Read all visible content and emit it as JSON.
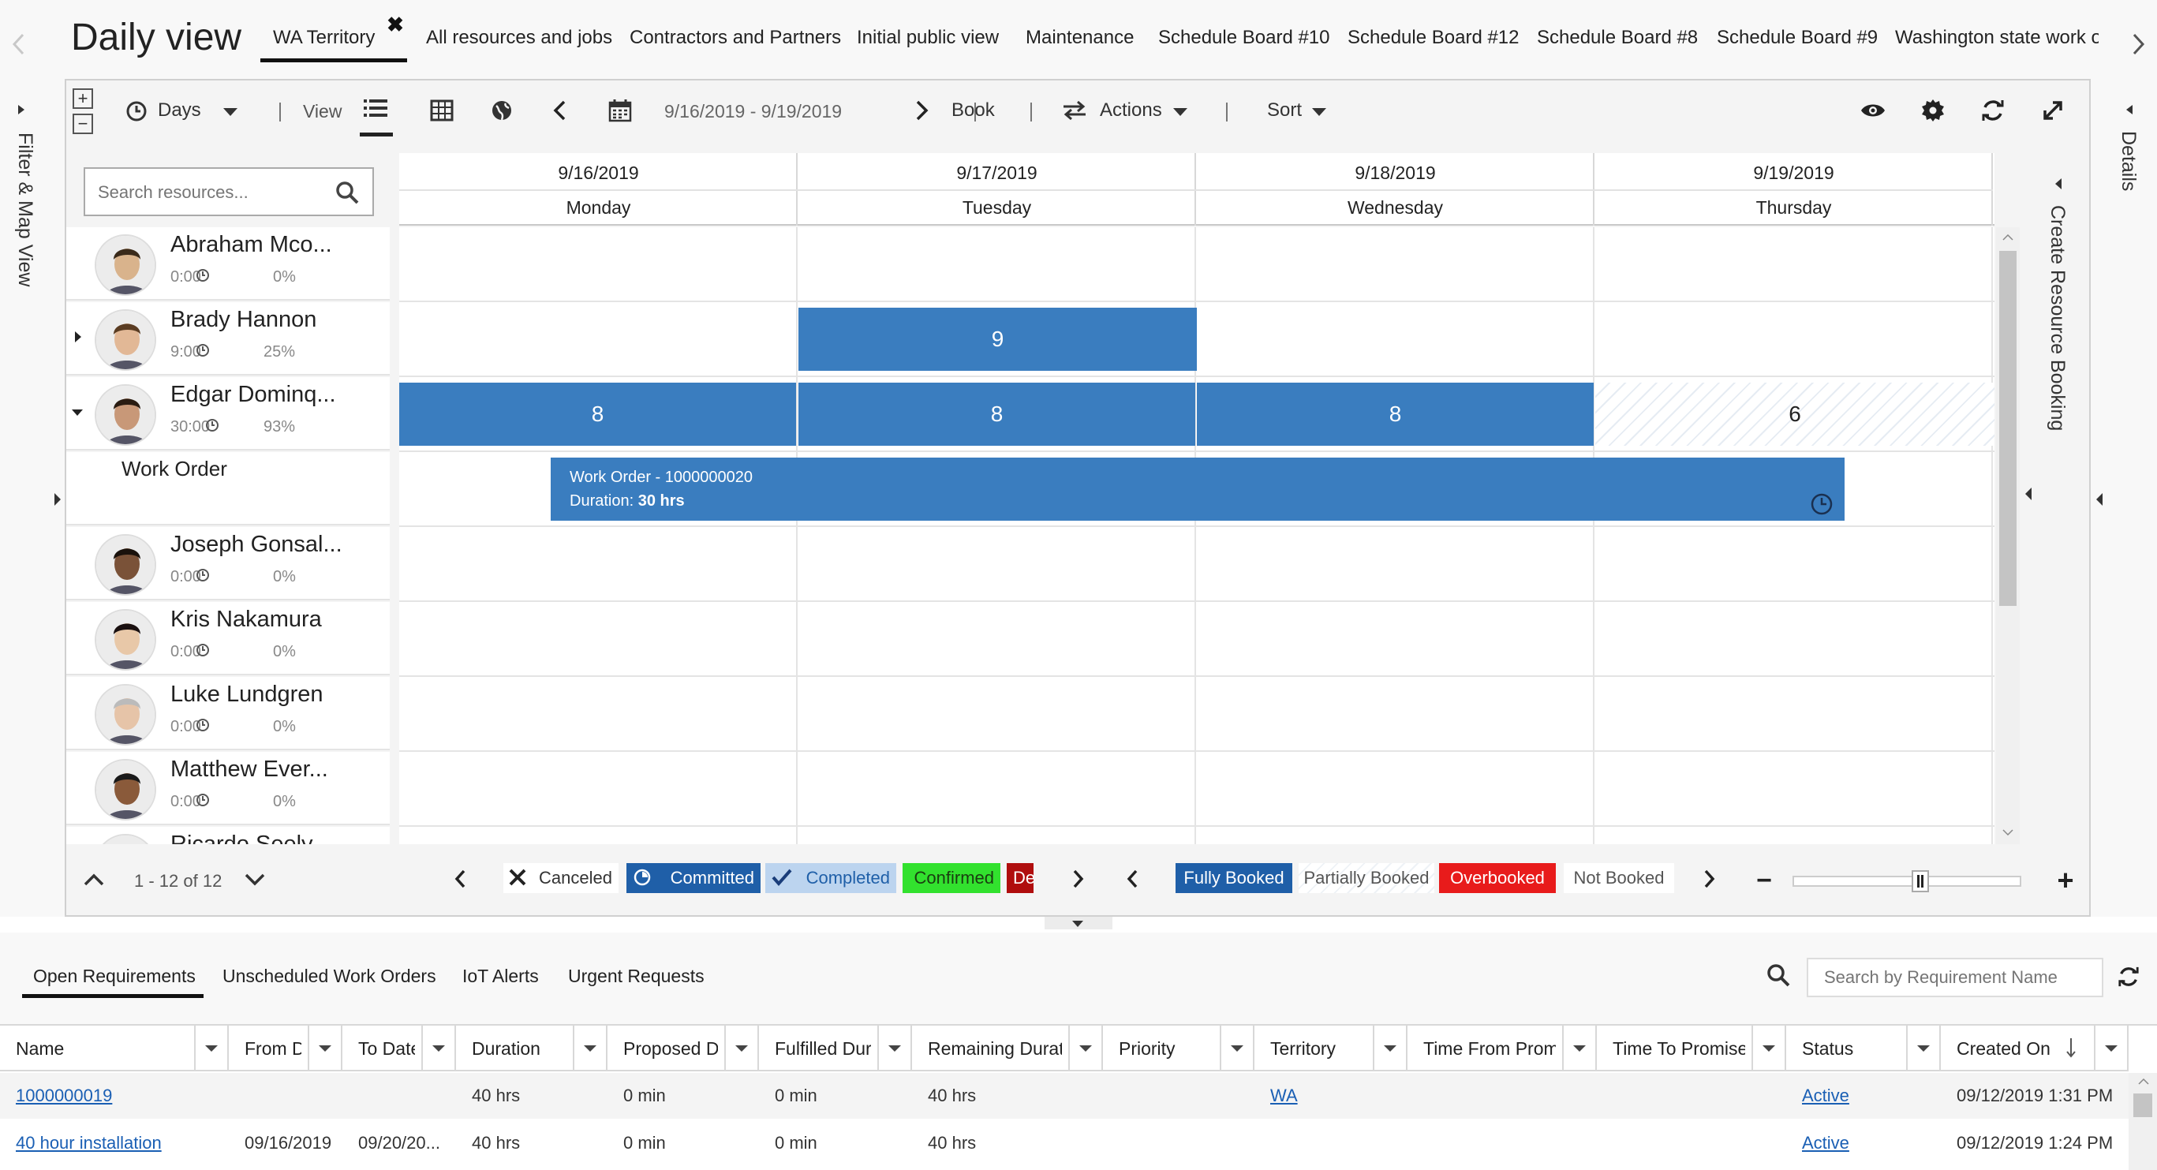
{
  "title": "Daily view",
  "tabs": [
    "WA Territory",
    "All resources and jobs",
    "Contractors and Partners",
    "Initial public view",
    "Maintenance",
    "Schedule Board #10",
    "Schedule Board #12",
    "Schedule Board #8",
    "Schedule Board #9",
    "Washington state work or"
  ],
  "toolbar": {
    "days": "Days",
    "view": "View",
    "date_range": "9/16/2019 - 9/19/2019",
    "book": "Book",
    "actions": "Actions",
    "sort": "Sort"
  },
  "side": {
    "left": "Filter & Map View",
    "right": "Details",
    "create": "Create Resource Booking"
  },
  "search": {
    "placeholder": "Search resources..."
  },
  "days": [
    {
      "date": "9/16/2019",
      "day": "Monday"
    },
    {
      "date": "9/17/2019",
      "day": "Tuesday"
    },
    {
      "date": "9/18/2019",
      "day": "Wednesday"
    },
    {
      "date": "9/19/2019",
      "day": "Thursday"
    }
  ],
  "resources": [
    {
      "name": "Abraham Mco...",
      "hours": "0:00",
      "pct": "0%"
    },
    {
      "name": "Brady Hannon",
      "hours": "9:00",
      "pct": "25%"
    },
    {
      "name": "Edgar Dominq...",
      "hours": "30:00",
      "pct": "93%"
    },
    {
      "name": "Joseph Gonsal...",
      "hours": "0:00",
      "pct": "0%"
    },
    {
      "name": "Kris Nakamura",
      "hours": "0:00",
      "pct": "0%"
    },
    {
      "name": "Luke Lundgren",
      "hours": "0:00",
      "pct": "0%"
    },
    {
      "name": "Matthew Ever...",
      "hours": "0:00",
      "pct": "0%"
    },
    {
      "name": "Ricardo Seely",
      "hours": "",
      "pct": ""
    }
  ],
  "subrow": {
    "label": "Work Order"
  },
  "bookings": {
    "brady_tue": "9",
    "edgar_mon": "8",
    "edgar_tue": "8",
    "edgar_wed": "8",
    "edgar_thu": "6"
  },
  "workorder": {
    "title": "Work Order - 1000000020",
    "duration_label": "Duration: ",
    "duration": "30 hrs"
  },
  "paging": "1 - 12 of 12",
  "legend_status": [
    {
      "label": "Canceled",
      "bg": "#ffffff",
      "fg": "#333333"
    },
    {
      "label": "Committed",
      "bg": "#1f5fa8",
      "fg": "#ffffff"
    },
    {
      "label": "Completed",
      "bg": "#bcd4ef",
      "fg": "#1f5fa8"
    },
    {
      "label": "Confirmed",
      "bg": "#32e12e",
      "fg": "#1a3d10"
    },
    {
      "label": "Del",
      "bg": "#b00e0e",
      "fg": "#ffffff"
    }
  ],
  "legend_capacity": [
    {
      "label": "Fully Booked",
      "bg": "#1f5fa8",
      "fg": "#ffffff"
    },
    {
      "label": "Partially Booked",
      "bg": "#ffffff",
      "fg": "#555555"
    },
    {
      "label": "Overbooked",
      "bg": "#e81b1b",
      "fg": "#ffffff"
    },
    {
      "label": "Not Booked",
      "bg": "#ffffff",
      "fg": "#555555"
    }
  ],
  "zoom": 0.55,
  "bottom_tabs": [
    "Open Requirements",
    "Unscheduled Work Orders",
    "IoT Alerts",
    "Urgent Requests"
  ],
  "req_search": {
    "placeholder": "Search by Requirement Name"
  },
  "grid": {
    "columns": [
      "Name",
      "From Da",
      "To Date",
      "Duration",
      "Proposed Du",
      "Fulfilled Dura",
      "Remaining Durati",
      "Priority",
      "Territory",
      "Time From Promi",
      "Time To Promised",
      "Status",
      "Created On"
    ],
    "rows": [
      [
        "1000000019",
        "",
        "",
        "40 hrs",
        "0 min",
        "0 min",
        "40 hrs",
        "",
        "WA",
        "",
        "",
        "Active",
        "09/12/2019 1:31 PM"
      ],
      [
        "40 hour installation",
        "09/16/2019",
        "09/20/20...",
        "40 hrs",
        "0 min",
        "0 min",
        "40 hrs",
        "",
        "",
        "",
        "",
        "Active",
        "09/12/2019 1:24 PM"
      ]
    ]
  },
  "colors": {
    "booking": "#3a7dbf",
    "accent": "#2266e3",
    "link": "#1a5fb4"
  }
}
